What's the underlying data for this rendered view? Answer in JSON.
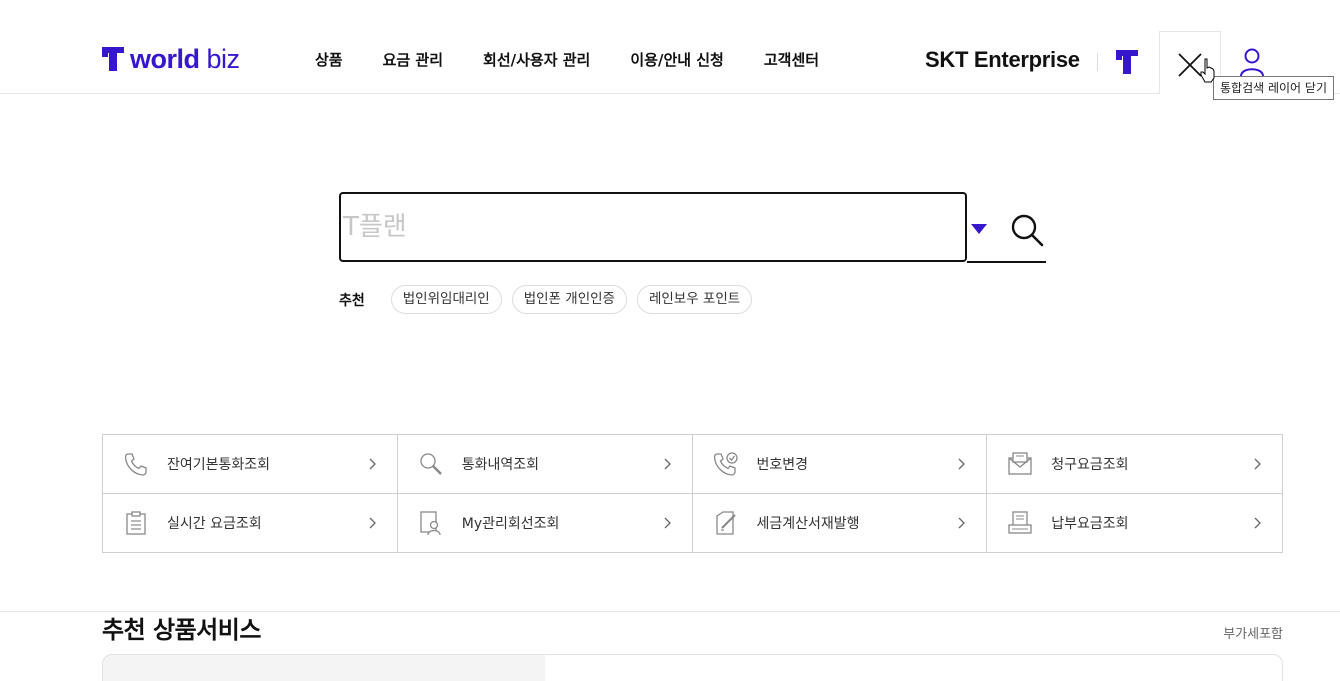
{
  "header": {
    "logo_text": "world",
    "logo_suffix": "biz",
    "nav": [
      "상품",
      "요금 관리",
      "회선/사용자 관리",
      "이용/안내 신청",
      "고객센터"
    ],
    "brand": "SKT Enterprise",
    "close_tooltip": "통합검색 레이어 닫기"
  },
  "search": {
    "placeholder": "T플랜",
    "recommend_label": "추천",
    "chips": [
      "법인위임대리인",
      "법인폰 개인인증",
      "레인보우 포인트"
    ]
  },
  "quick_menu": [
    {
      "label": "잔여기본통화조회",
      "icon": "phone-icon"
    },
    {
      "label": "통화내역조회",
      "icon": "magnifier-icon"
    },
    {
      "label": "번호변경",
      "icon": "phone-check-icon"
    },
    {
      "label": "청구요금조회",
      "icon": "envelope-icon"
    },
    {
      "label": "실시간 요금조회",
      "icon": "clipboard-icon"
    },
    {
      "label": "My관리회선조회",
      "icon": "user-document-icon"
    },
    {
      "label": "세금계산서재발행",
      "icon": "document-edit-icon"
    },
    {
      "label": "납부요금조회",
      "icon": "printer-icon"
    }
  ],
  "section": {
    "title": "추천 상품서비스",
    "note": "부가세포함"
  },
  "colors": {
    "brand": "#3617ce",
    "text": "#111111",
    "border": "#cfcfcf"
  }
}
